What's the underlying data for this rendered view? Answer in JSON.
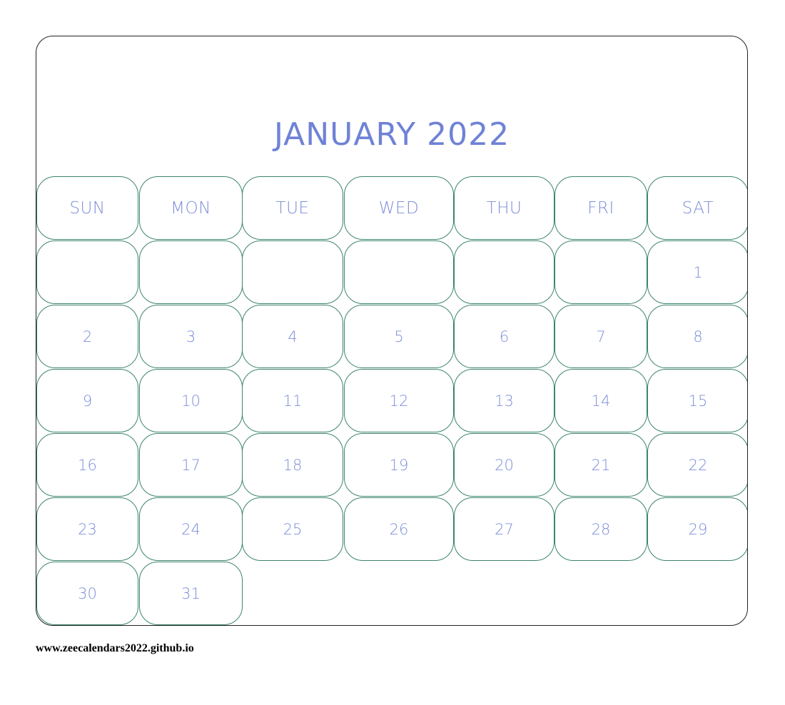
{
  "calendar": {
    "title": "JANUARY 2022",
    "weekdays": [
      "SUN",
      "MON",
      "TUE",
      "WED",
      "THU",
      "FRI",
      "SAT"
    ],
    "first_weekday_index": 6,
    "days_in_month": 31,
    "colors": {
      "title": "#6f82d6",
      "day_text": "#7e8fd8",
      "cell_border": "#3c8470",
      "frame_border": "#222222"
    }
  },
  "footer": {
    "url": "www.zeecalendars2022.github.io"
  }
}
